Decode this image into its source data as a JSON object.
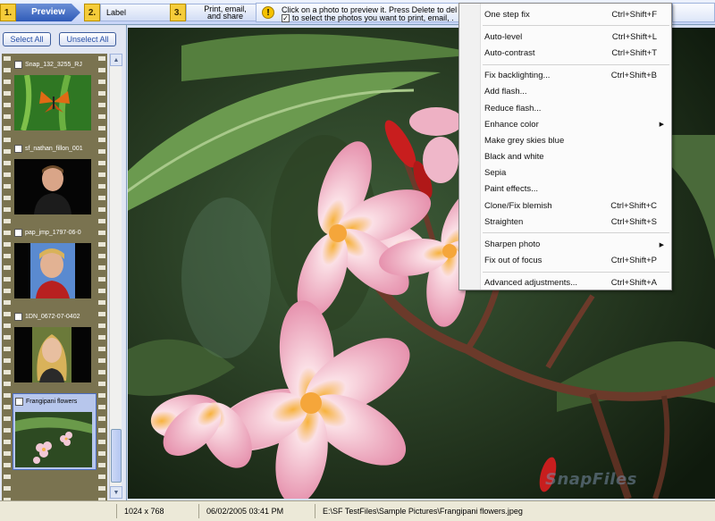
{
  "steps": [
    {
      "num": "1.",
      "label": "Preview"
    },
    {
      "num": "2.",
      "label": "Label"
    },
    {
      "num": "3.",
      "label": "Print, email,\nand share"
    }
  ],
  "info": {
    "icon": "warning-icon",
    "line1": "Click on a photo to preview it.  Press Delete to del",
    "line2": "to select the photos you want to print, email, ."
  },
  "sidebar": {
    "select_all": "Select All",
    "unselect_all": "Unselect All",
    "thumbnails": [
      {
        "name": "Snap_132_3255_RJ",
        "checked": true,
        "selected": false
      },
      {
        "name": "sf_nathan_fillon_001",
        "checked": false,
        "selected": false
      },
      {
        "name": "pap_jmp_1797-06-0",
        "checked": false,
        "selected": false
      },
      {
        "name": "1DN_0672-07-0402",
        "checked": false,
        "selected": false
      },
      {
        "name": "Frangipani flowers",
        "checked": false,
        "selected": true
      }
    ]
  },
  "menu": {
    "items": [
      {
        "label": "One step fix",
        "shortcut": "Ctrl+Shift+F"
      },
      {
        "sep": true
      },
      {
        "label": "Auto-level",
        "shortcut": "Ctrl+Shift+L"
      },
      {
        "label": "Auto-contrast",
        "shortcut": "Ctrl+Shift+T"
      },
      {
        "sep": true
      },
      {
        "label": "Fix backlighting...",
        "shortcut": "Ctrl+Shift+B"
      },
      {
        "label": "Add flash...",
        "shortcut": ""
      },
      {
        "label": "Reduce flash...",
        "shortcut": ""
      },
      {
        "label": "Enhance color",
        "shortcut": "",
        "submenu": true
      },
      {
        "label": "Make grey skies blue",
        "shortcut": ""
      },
      {
        "label": "Black and white",
        "shortcut": ""
      },
      {
        "label": "Sepia",
        "shortcut": ""
      },
      {
        "label": "Paint effects...",
        "shortcut": ""
      },
      {
        "label": "Clone/Fix blemish",
        "shortcut": "Ctrl+Shift+C"
      },
      {
        "label": "Straighten",
        "shortcut": "Ctrl+Shift+S"
      },
      {
        "sep": true
      },
      {
        "label": "Sharpen photo",
        "shortcut": "",
        "submenu": true
      },
      {
        "label": "Fix out of focus",
        "shortcut": "Ctrl+Shift+P"
      },
      {
        "sep": true
      },
      {
        "label": "Advanced adjustments...",
        "shortcut": "Ctrl+Shift+A"
      }
    ]
  },
  "status": {
    "dimensions": "1024 x 768",
    "date": "06/02/2005  03:41 PM",
    "path": "E:\\SF TestFiles\\Sample Pictures\\Frangipani flowers.jpeg"
  },
  "watermark": "SnapFiles",
  "colors": {
    "accent": "#2f5bb8",
    "step_number": "#f5cc3a",
    "filmstrip": "#7a7350"
  }
}
